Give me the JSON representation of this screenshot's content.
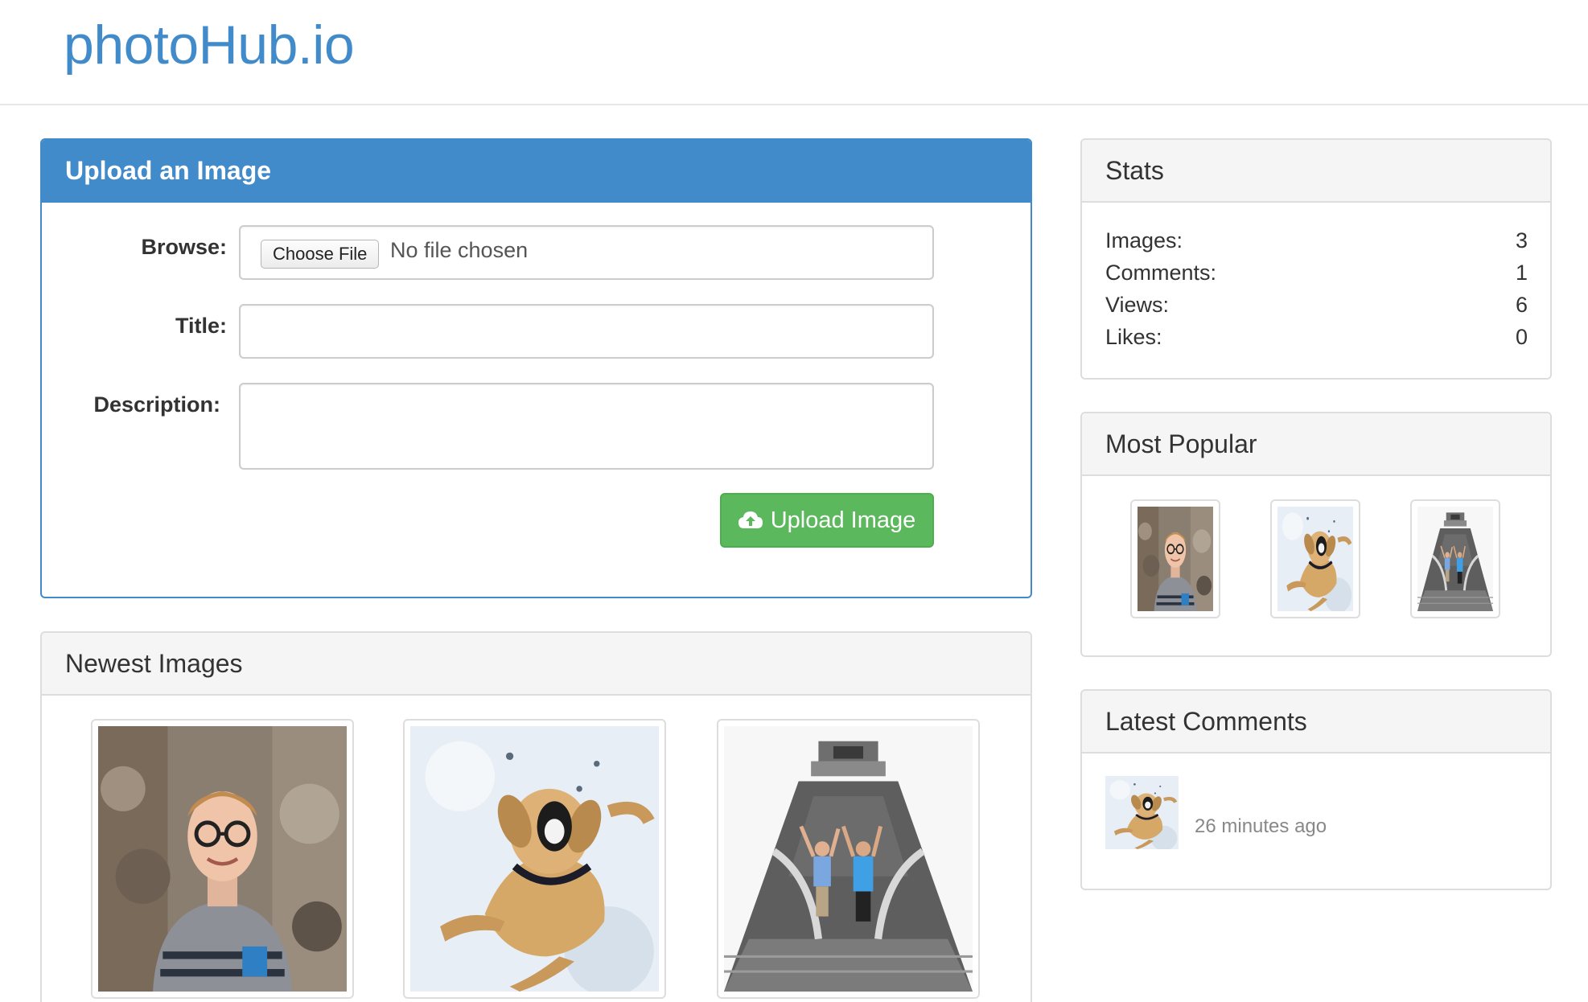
{
  "brand": "photoHub.io",
  "upload": {
    "heading": "Upload an Image",
    "browse_label": "Browse:",
    "choose_file_label": "Choose File",
    "file_status": "No file chosen",
    "title_label": "Title:",
    "title_value": "",
    "description_label": "Description:",
    "description_value": "",
    "upload_button_label": "Upload Image",
    "upload_icon": "cloud-upload-icon"
  },
  "newest": {
    "heading": "Newest Images",
    "images": [
      {
        "subject": "man-with-glasses"
      },
      {
        "subject": "dog-in-snow"
      },
      {
        "subject": "people-on-pyramid"
      }
    ]
  },
  "stats": {
    "heading": "Stats",
    "rows": [
      {
        "label": "Images:",
        "value": "3"
      },
      {
        "label": "Comments:",
        "value": "1"
      },
      {
        "label": "Views:",
        "value": "6"
      },
      {
        "label": "Likes:",
        "value": "0"
      }
    ]
  },
  "popular": {
    "heading": "Most Popular",
    "images": [
      {
        "subject": "man-with-glasses"
      },
      {
        "subject": "dog-in-snow"
      },
      {
        "subject": "people-on-pyramid"
      }
    ]
  },
  "comments": {
    "heading": "Latest Comments",
    "items": [
      {
        "subject": "dog-in-snow",
        "time": "26 minutes ago"
      }
    ]
  },
  "colors": {
    "brand": "#428bca",
    "primary": "#428bca",
    "success": "#5cb85c",
    "panel_heading_bg": "#f5f5f5",
    "muted_text": "#888888"
  }
}
